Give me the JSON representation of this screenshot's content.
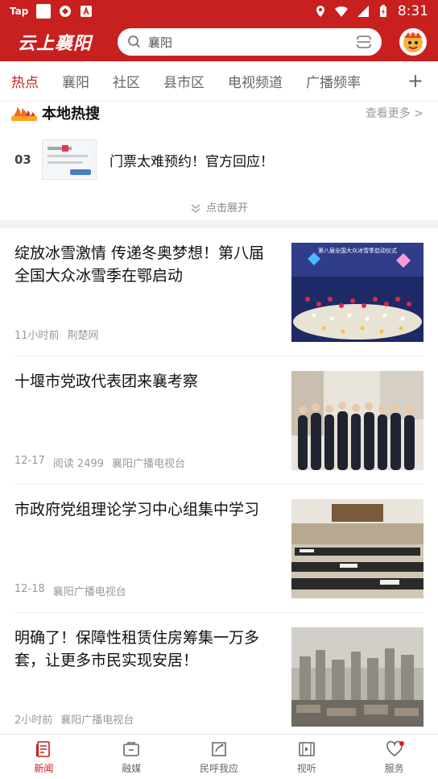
{
  "status_bar": {
    "carrier_icon_text": "Tap",
    "time": "8:31"
  },
  "header": {
    "logo": "云上襄阳",
    "search_text": "襄阳"
  },
  "tabs": [
    {
      "label": "热点",
      "active": true
    },
    {
      "label": "襄阳",
      "active": false
    },
    {
      "label": "社区",
      "active": false
    },
    {
      "label": "县市区",
      "active": false
    },
    {
      "label": "电视频道",
      "active": false
    },
    {
      "label": "广播频率",
      "active": false
    }
  ],
  "hot_search": {
    "title": "本地热搜",
    "more": "查看更多 >",
    "item": {
      "rank": "03",
      "text": "门票太难预约！官方回应！"
    },
    "expand": "点击展开"
  },
  "news": [
    {
      "title": "绽放冰雪激情 传递冬奥梦想！第八届全国大众冰雪季在鄂启动",
      "meta": [
        "11小时前",
        "荆楚网"
      ],
      "thumb_caption": "第八届全国大众冰雪季启动仪式"
    },
    {
      "title": "十堰市党政代表团来襄考察",
      "meta": [
        "12-17",
        "阅读 2499",
        "襄阳广播电视台"
      ]
    },
    {
      "title": "市政府党组理论学习中心组集中学习",
      "meta": [
        "12-18",
        "襄阳广播电视台"
      ]
    },
    {
      "title": "明确了！保障性租赁住房筹集一万多套，让更多市民实现安居！",
      "meta": [
        "2小时前",
        "襄阳广播电视台"
      ]
    }
  ],
  "bottom_nav": [
    {
      "label": "新闻",
      "icon": "news-icon",
      "active": true
    },
    {
      "label": "融媒",
      "icon": "media-icon",
      "active": false
    },
    {
      "label": "民呼我应",
      "icon": "feedback-icon",
      "active": false
    },
    {
      "label": "视听",
      "icon": "video-icon",
      "active": false
    },
    {
      "label": "服务",
      "icon": "heart-icon",
      "active": false
    }
  ],
  "colors": {
    "brand": "#c8201f"
  }
}
